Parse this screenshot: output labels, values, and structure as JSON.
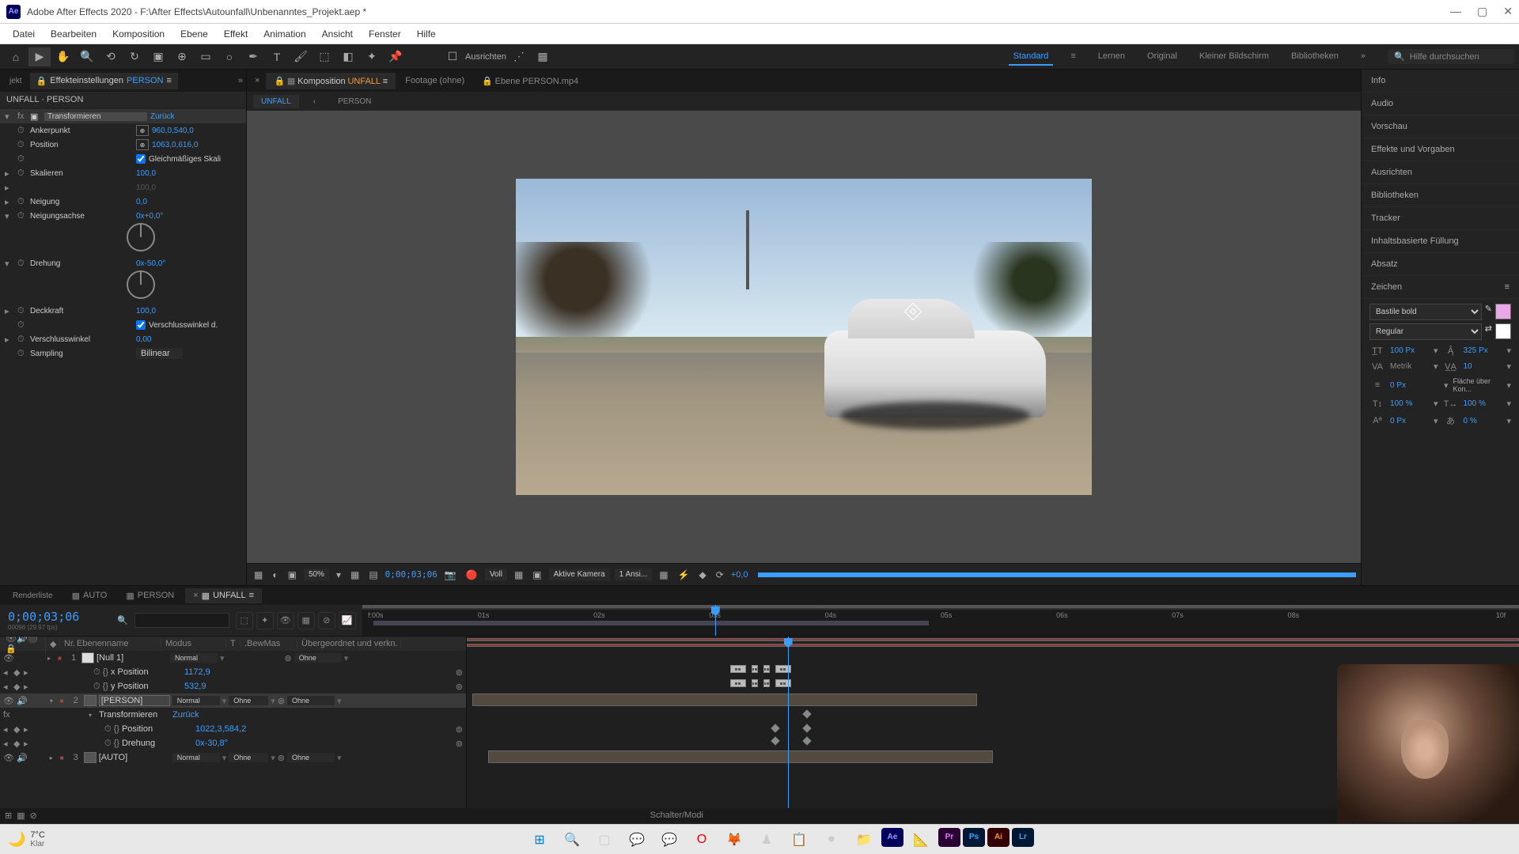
{
  "titlebar": {
    "app": "Ae",
    "title": "Adobe After Effects 2020 - F:\\After Effects\\Autounfall\\Unbenanntes_Projekt.aep *"
  },
  "menu": [
    "Datei",
    "Bearbeiten",
    "Komposition",
    "Ebene",
    "Effekt",
    "Animation",
    "Ansicht",
    "Fenster",
    "Hilfe"
  ],
  "toolbar": {
    "align": "Ausrichten"
  },
  "workspaces": {
    "items": [
      "Standard",
      "Lernen",
      "Original",
      "Kleiner Bildschirm",
      "Bibliotheken"
    ],
    "active": "Standard"
  },
  "search_placeholder": "Hilfe durchsuchen",
  "left_tabs": {
    "jekt": "jekt",
    "ec": "Effekteinstellungen",
    "ec_target": "PERSON"
  },
  "effect_header": "UNFALL · PERSON",
  "ec": {
    "fx": "fx",
    "transform": "Transformieren",
    "reset": "Zurück",
    "anchor": "Ankerpunkt",
    "anchor_v": "960,0,540,0",
    "position": "Position",
    "position_v": "1063,0,616,0",
    "uniform": "Gleichmäßiges Skali",
    "scale": "Skalieren",
    "scale_v": "100,0",
    "scale_v2": "100,0",
    "skew": "Neigung",
    "skew_v": "0,0",
    "skew_axis": "Neigungsachse",
    "skew_axis_v": "0x+0,0°",
    "rotation": "Drehung",
    "rotation_v": "0x-50,0°",
    "opacity": "Deckkraft",
    "opacity_v": "100,0",
    "shutter_use": "Verschlusswinkel d.",
    "shutter": "Verschlusswinkel",
    "shutter_v": "0,00",
    "sampling": "Sampling",
    "sampling_v": "Bilinear"
  },
  "comp_tabs": {
    "comp": "Komposition",
    "comp_name": "UNFALL",
    "footage": "Footage",
    "footage_v": "(ohne)",
    "layer": "Ebene",
    "layer_v": "PERSON.mp4"
  },
  "subtabs": {
    "unfall": "UNFALL",
    "person": "PERSON"
  },
  "viewer": {
    "zoom": "50%",
    "timecode": "0;00;03;06",
    "res": "Voll",
    "camera": "Aktive Kamera",
    "views": "1 Ansi...",
    "exposure": "+0,0"
  },
  "right_panels": [
    "Info",
    "Audio",
    "Vorschau",
    "Effekte und Vorgaben",
    "Ausrichten",
    "Bibliotheken",
    "Tracker",
    "Inhaltsbasierte Füllung",
    "Absatz",
    "Zeichen"
  ],
  "char": {
    "font": "Bastile bold",
    "style": "Regular",
    "size": "100 Px",
    "leading": "325 Px",
    "kerning": "Metrik",
    "tracking": "10",
    "stroke": "0 Px",
    "stroke_opt": "Fläche über Kon...",
    "vscale": "100 %",
    "hscale": "100 %",
    "baseline": "0 Px",
    "tsume": "0 %"
  },
  "bottom_tabs": {
    "render": "Renderliste",
    "auto": "AUTO",
    "person": "PERSON",
    "unfall": "UNFALL"
  },
  "tl": {
    "timecode": "0;00;03;06",
    "fps": "00096 (29.97 fps)",
    "cols": {
      "av": "",
      "nr": "Nr.",
      "name": "Ebenenname",
      "mode": "Modus",
      "t": "T",
      "bew": ".BewMas",
      "parent": "Übergeordnet und verkn."
    },
    "sec": [
      "f:00s",
      "01s",
      "02s",
      "03s",
      "04s",
      "05s",
      "06s",
      "07s",
      "08s",
      "10f"
    ],
    "layers": [
      {
        "n": "1",
        "name": "[Null 1]",
        "mode": "Normal",
        "parent": "Ohne"
      },
      {
        "prop": "x Position",
        "val": "1172,9"
      },
      {
        "prop": "y Position",
        "val": "532,9"
      },
      {
        "n": "2",
        "name": "[PERSON]",
        "mode": "Normal",
        "bew": "Ohne",
        "parent": "Ohne",
        "selected": true
      },
      {
        "prop": "Transformieren",
        "val": "Zurück",
        "fx": true
      },
      {
        "prop": "Position",
        "val": "1022,3,584,2"
      },
      {
        "prop": "Drehung",
        "val": "0x-30,8°"
      },
      {
        "n": "3",
        "name": "[AUTO]",
        "mode": "Normal",
        "bew": "Ohne",
        "parent": "Ohne"
      }
    ],
    "footer": "Schalter/Modi"
  },
  "taskbar": {
    "temp": "7°C",
    "cond": "Klar",
    "apps": {
      "ae": "Ae",
      "pr": "Pr",
      "ps": "Ps",
      "ai": "Ai",
      "lr": "Lr"
    }
  }
}
